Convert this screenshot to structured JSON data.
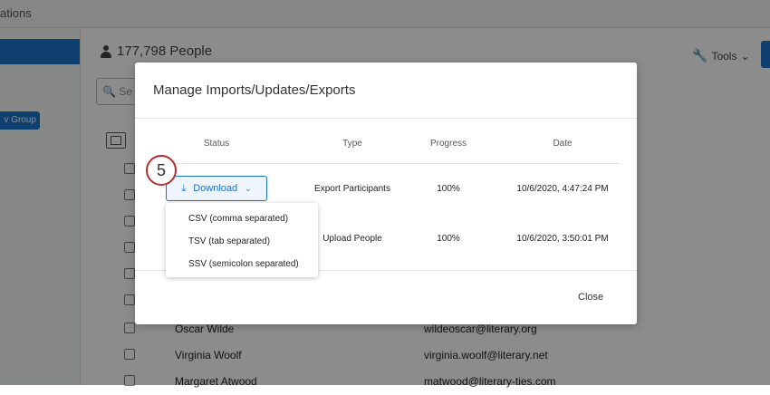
{
  "topbar": {
    "label": "ations"
  },
  "sidebar": {
    "new_group_label": "v Group"
  },
  "header": {
    "people_count": "177,798 People",
    "tools_label": "Tools",
    "tools_chevron": "⌄",
    "wrench_glyph": "🔧"
  },
  "search": {
    "placeholder_visible": "Se"
  },
  "background_rows": [
    {
      "name": "Oscar Wilde",
      "email": "wildeoscar@literary.org"
    },
    {
      "name": "Virginia Woolf",
      "email": "virginia.woolf@literary.net"
    },
    {
      "name": "Margaret Atwood",
      "email": "matwood@literary-ties.com"
    }
  ],
  "modal": {
    "title": "Manage Imports/Updates/Exports",
    "columns": {
      "status": "Status",
      "type": "Type",
      "progress": "Progress",
      "date": "Date"
    },
    "rows": [
      {
        "type": "Export Participants",
        "progress": "100%",
        "date": "10/6/2020, 4:47:24 PM"
      },
      {
        "type": "Upload People",
        "progress": "100%",
        "date": "10/6/2020, 3:50:01 PM"
      }
    ],
    "download": {
      "label": "Download",
      "icon_glyph": "⤓",
      "chevron_glyph": "⌄"
    },
    "step_badge": "5",
    "dropdown_options": [
      "CSV (comma separated)",
      "TSV (tab separated)",
      "SSV (semicolon separated)"
    ],
    "close_label": "Close"
  },
  "colors": {
    "accent": "#1a73c8",
    "badge_ring": "#b52e2e",
    "overlay": "rgba(0,0,0,0.45)"
  },
  "icons": {
    "person": "person-icon",
    "wrench": "wrench-icon",
    "search": "search-icon",
    "download": "download-icon",
    "chevron": "chevron-down-icon"
  }
}
